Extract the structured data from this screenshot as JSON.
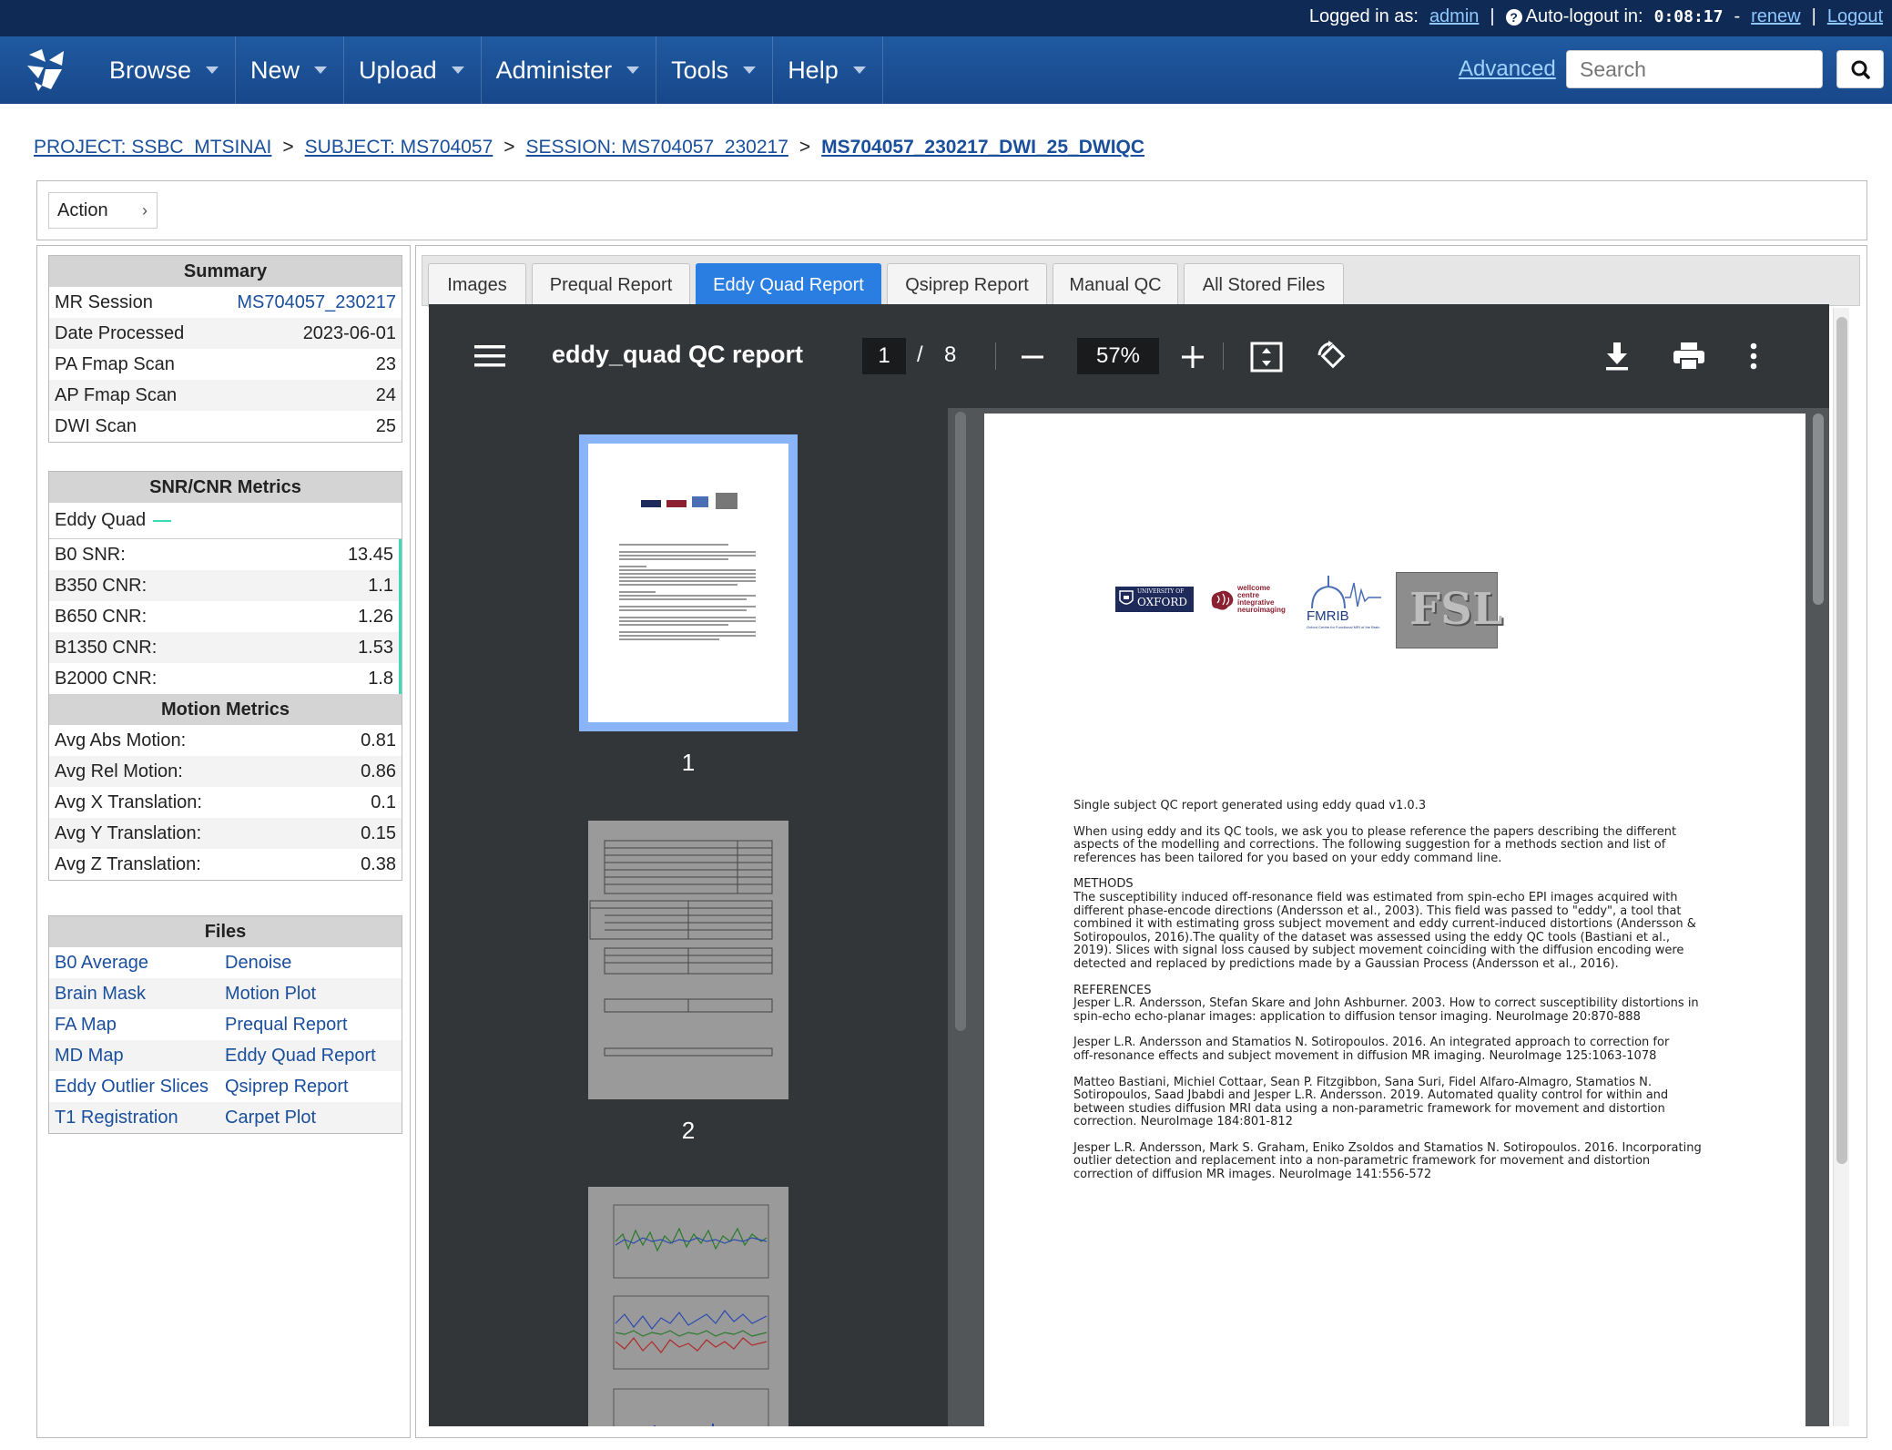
{
  "topbar": {
    "logged_in_label": "Logged in as:",
    "user": "admin",
    "autologout_label": "Auto-logout in:",
    "timer": "0:08:17",
    "renew": "renew",
    "logout": "Logout",
    "separator": "|",
    "dash": "-"
  },
  "nav": {
    "items": [
      "Browse",
      "New",
      "Upload",
      "Administer",
      "Tools",
      "Help"
    ],
    "advanced": "Advanced",
    "search_placeholder": "Search"
  },
  "breadcrumb": {
    "project": "PROJECT: SSBC_MTSINAI",
    "subject": "SUBJECT: MS704057",
    "session": "SESSION: MS704057_230217",
    "current": "MS704057_230217_DWI_25_DWIQC",
    "sep": ">"
  },
  "action": {
    "label": "Action"
  },
  "summary": {
    "title": "Summary",
    "rows": [
      {
        "label": "MR Session",
        "value": "MS704057_230217"
      },
      {
        "label": "Date Processed",
        "value": "2023-06-01"
      },
      {
        "label": "PA Fmap Scan",
        "value": "23"
      },
      {
        "label": "AP Fmap Scan",
        "value": "24"
      },
      {
        "label": "DWI Scan",
        "value": "25"
      }
    ]
  },
  "snr": {
    "title": "SNR/CNR Metrics",
    "eddy_label": "Eddy Quad",
    "rows": [
      {
        "label": "B0 SNR:",
        "value": "13.45"
      },
      {
        "label": "B350 CNR:",
        "value": "1.1"
      },
      {
        "label": "B650 CNR:",
        "value": "1.26"
      },
      {
        "label": "B1350 CNR:",
        "value": "1.53"
      },
      {
        "label": "B2000 CNR:",
        "value": "1.8"
      }
    ]
  },
  "motion": {
    "title": "Motion Metrics",
    "rows": [
      {
        "label": "Avg Abs Motion:",
        "value": "0.81"
      },
      {
        "label": "Avg Rel Motion:",
        "value": "0.86"
      },
      {
        "label": "Avg X Translation:",
        "value": "0.1"
      },
      {
        "label": "Avg Y Translation:",
        "value": "0.15"
      },
      {
        "label": "Avg Z Translation:",
        "value": "0.38"
      }
    ]
  },
  "files": {
    "title": "Files",
    "rows": [
      [
        "B0 Average",
        "Denoise"
      ],
      [
        "Brain Mask",
        "Motion Plot"
      ],
      [
        "FA Map",
        "Prequal Report"
      ],
      [
        "MD Map",
        "Eddy Quad Report"
      ],
      [
        "Eddy Outlier Slices",
        "Qsiprep Report"
      ],
      [
        "T1 Registration",
        "Carpet Plot"
      ]
    ]
  },
  "tabs": [
    "Images",
    "Prequal Report",
    "Eddy Quad Report",
    "Qsiprep Report",
    "Manual QC",
    "All Stored Files"
  ],
  "active_tab": "Eddy Quad Report",
  "pdf": {
    "title": "eddy_quad QC report",
    "page": "1",
    "page_sep": "/",
    "total_pages": "8",
    "zoom": "57%",
    "thumb_labels": [
      "1",
      "2"
    ],
    "logos": {
      "oxford_small": "UNIVERSITY OF",
      "oxford": "OXFORD",
      "wellcome_1": "wellcome",
      "wellcome_2": "centre",
      "wellcome_3": "integrative",
      "wellcome_4": "neuroimaging",
      "fmrib": "FMRIB",
      "fmrib_sub": "Oxford Centre for Functional MRI of the Brain",
      "fsl": "FSL"
    },
    "paragraphs": [
      "Single subject QC report generated using eddy quad v1.0.3",
      "When using eddy and its QC tools, we ask you to please reference the papers describing the different\naspects of the modelling and corrections. The following suggestion for a methods section and list of\nreferences has been tailored for you based on your eddy command line.",
      "METHODS\nThe susceptibility induced off-resonance field was estimated from spin-echo EPI images acquired with\ndifferent phase-encode directions (Andersson et al., 2003). This field was passed to \"eddy\", a tool that\ncombined it with estimating gross subject movement and eddy current-induced distortions (Andersson &\nSotiropoulos, 2016).The quality of the dataset was assessed using the eddy QC tools (Bastiani et al.,\n2019). Slices with signal loss caused by subject movement coinciding with the diffusion encoding were\ndetected and replaced by predictions made by a Gaussian Process (Andersson et al., 2016).",
      "REFERENCES\nJesper L.R. Andersson, Stefan Skare and John Ashburner. 2003. How to correct susceptibility distortions in\nspin-echo echo-planar images: application to diffusion tensor imaging. NeuroImage 20:870-888",
      "Jesper L.R. Andersson and Stamatios N. Sotiropoulos. 2016. An integrated approach to correction for\noff-resonance effects and subject movement in diffusion MR imaging. NeuroImage 125:1063-1078",
      "Matteo Bastiani, Michiel Cottaar, Sean P. Fitzgibbon, Sana Suri, Fidel Alfaro-Almagro, Stamatios N.\nSotiropoulos, Saad Jbabdi and Jesper L.R. Andersson. 2019. Automated quality control for within and\nbetween studies diffusion MRI data using a non-parametric framework for movement and distortion\ncorrection. NeuroImage 184:801-812",
      "Jesper L.R. Andersson, Mark S. Graham, Eniko Zsoldos and Stamatios N. Sotiropoulos. 2016. Incorporating\noutlier detection and replacement into a non-parametric framework for movement and distortion\ncorrection of diffusion MR images. NeuroImage 141:556-572"
    ]
  },
  "colors": {
    "topbar": "#0f2a55",
    "navbar": "#1f5aa0",
    "active_tab": "#2a7de1",
    "link": "#1a4f9c",
    "metrics_accent": "#3ed9b8"
  }
}
